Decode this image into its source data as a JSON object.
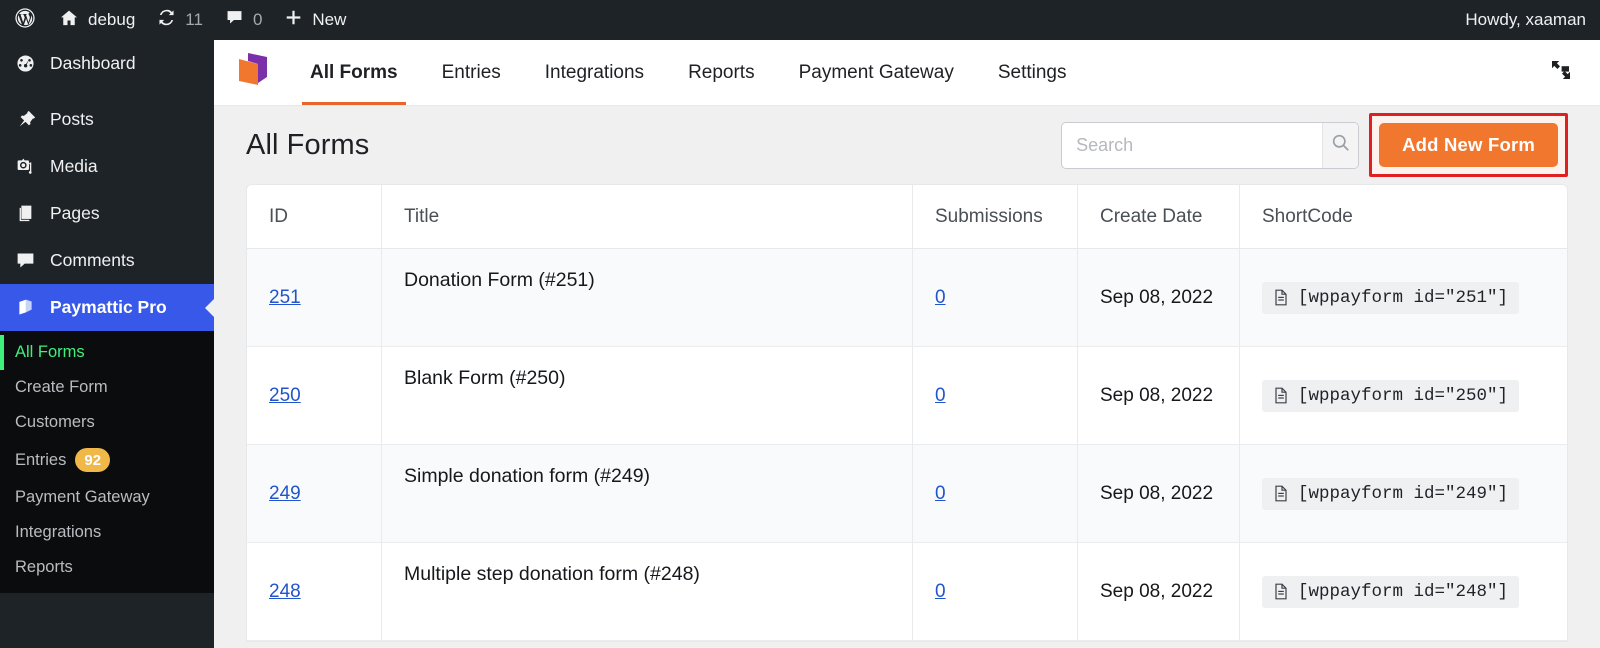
{
  "adminbar": {
    "wp_logo_icon": "wordpress-logo-icon",
    "site_icon": "home-icon",
    "site_name": "debug",
    "updates_icon": "updates-refresh-icon",
    "updates_count": "11",
    "comments_icon": "comment-bubble-icon",
    "comments_count": "0",
    "new_icon": "plus-icon",
    "new_label": "New",
    "howdy": "Howdy, xaaman"
  },
  "sidebar": {
    "items": [
      {
        "label": "Dashboard",
        "icon": "dashboard-icon"
      },
      {
        "label": "Posts",
        "icon": "pin-icon"
      },
      {
        "label": "Media",
        "icon": "media-icon"
      },
      {
        "label": "Pages",
        "icon": "pages-icon"
      },
      {
        "label": "Comments",
        "icon": "comment-icon"
      },
      {
        "label": "Paymattic Pro",
        "icon": "paymattic-icon"
      }
    ],
    "submenu": [
      {
        "label": "All Forms",
        "current": true
      },
      {
        "label": "Create Form"
      },
      {
        "label": "Customers"
      },
      {
        "label": "Entries",
        "badge": "92"
      },
      {
        "label": "Payment Gateway"
      },
      {
        "label": "Integrations"
      },
      {
        "label": "Reports"
      }
    ],
    "active_color": "#3858e9",
    "current_color": "#3ef07c",
    "badge_color": "#f0b849"
  },
  "topnav": {
    "logo_icon": "paymattic-logo-icon",
    "tabs": [
      {
        "label": "All Forms",
        "active": true
      },
      {
        "label": "Entries"
      },
      {
        "label": "Integrations"
      },
      {
        "label": "Reports"
      },
      {
        "label": "Payment Gateway"
      },
      {
        "label": "Settings"
      }
    ],
    "expand_icon": "fullscreen-expand-icon",
    "active_underline_color": "#e8662a"
  },
  "page": {
    "title": "All Forms",
    "search": {
      "placeholder": "Search",
      "value": "",
      "icon": "search-icon"
    },
    "add_button": {
      "label": "Add New Form",
      "color": "#f1772e",
      "highlight_color": "#e02020"
    }
  },
  "table": {
    "columns": [
      "ID",
      "Title",
      "Submissions",
      "Create Date",
      "ShortCode"
    ],
    "shortcode_icon": "document-copy-icon",
    "rows": [
      {
        "id": "251",
        "title": "Donation Form (#251)",
        "submissions": "0",
        "date": "Sep 08, 2022",
        "shortcode": "[wppayform id=\"251\"]"
      },
      {
        "id": "250",
        "title": "Blank Form (#250)",
        "submissions": "0",
        "date": "Sep 08, 2022",
        "shortcode": "[wppayform id=\"250\"]"
      },
      {
        "id": "249",
        "title": "Simple donation form (#249)",
        "submissions": "0",
        "date": "Sep 08, 2022",
        "shortcode": "[wppayform id=\"249\"]"
      },
      {
        "id": "248",
        "title": "Multiple step donation form (#248)",
        "submissions": "0",
        "date": "Sep 08, 2022",
        "shortcode": "[wppayform id=\"248\"]"
      }
    ]
  }
}
